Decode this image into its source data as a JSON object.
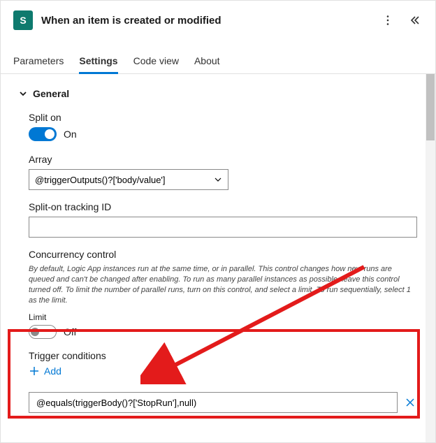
{
  "header": {
    "icon_letter": "S",
    "title": "When an item is created or modified"
  },
  "tabs": {
    "parameters": "Parameters",
    "settings": "Settings",
    "code_view": "Code view",
    "about": "About"
  },
  "general": {
    "title": "General",
    "split_on": {
      "label": "Split on",
      "state": "On"
    },
    "array": {
      "label": "Array",
      "value": "@triggerOutputs()?['body/value']"
    },
    "tracking_id": {
      "label": "Split-on tracking ID",
      "value": ""
    },
    "concurrency": {
      "label": "Concurrency control",
      "description": "By default, Logic App instances run at the same time, or in parallel. This control changes how new runs are queued and can't be changed after enabling. To run as many parallel instances as possible, leave this control turned off. To limit the number of parallel runs, turn on this control, and select a limit. To run sequentially, select 1 as the limit.",
      "limit_label": "Limit",
      "state": "Off"
    },
    "trigger_conditions": {
      "label": "Trigger conditions",
      "add": "Add",
      "condition_value": "@equals(triggerBody()?['StopRun'],null)"
    }
  }
}
